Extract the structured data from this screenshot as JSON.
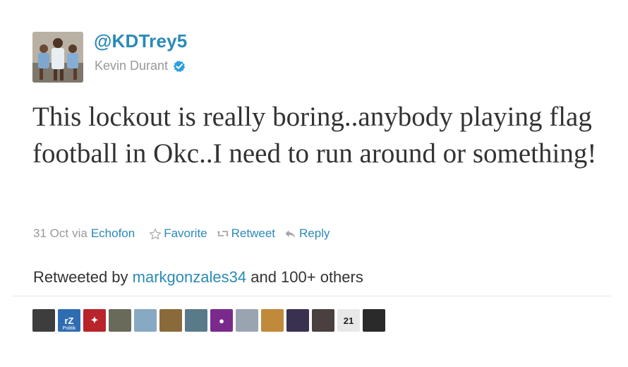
{
  "profile": {
    "handle": "@KDTrey5",
    "name": "Kevin Durant",
    "verified": true,
    "avatar_icon": "avatar-photo-icon"
  },
  "tweet": {
    "text": "This lockout is really boring..anybody playing flag football in Okc..I need to run around or something!"
  },
  "meta": {
    "date": "31 Oct",
    "via_label": "via",
    "source": "Echofon",
    "favorite_label": "Favorite",
    "retweet_label": "Retweet",
    "reply_label": "Reply"
  },
  "retweeted": {
    "prefix": "Retweeted by",
    "user": "markgonzales34",
    "suffix": "and 100+ others"
  },
  "retweeters": [
    {
      "name": "retweeter-avatar-1",
      "color": "#3d3d3d",
      "text": ""
    },
    {
      "name": "retweeter-avatar-2",
      "color": "#2f6db3",
      "text": "rZ",
      "sub": "Politik"
    },
    {
      "name": "retweeter-avatar-3",
      "color": "#b8242a",
      "text": "✦"
    },
    {
      "name": "retweeter-avatar-4",
      "color": "#6a6a5a",
      "text": ""
    },
    {
      "name": "retweeter-avatar-5",
      "color": "#87a9c4",
      "text": ""
    },
    {
      "name": "retweeter-avatar-6",
      "color": "#8a6a3a",
      "text": ""
    },
    {
      "name": "retweeter-avatar-7",
      "color": "#5a7a8a",
      "text": ""
    },
    {
      "name": "retweeter-avatar-8",
      "color": "#7a2a8a",
      "text": "●"
    },
    {
      "name": "retweeter-avatar-9",
      "color": "#9aa4b0",
      "text": ""
    },
    {
      "name": "retweeter-avatar-10",
      "color": "#c08a3a",
      "text": ""
    },
    {
      "name": "retweeter-avatar-11",
      "color": "#3a3050",
      "text": ""
    },
    {
      "name": "retweeter-avatar-12",
      "color": "#4a4040",
      "text": ""
    },
    {
      "name": "retweeter-avatar-13",
      "color": "#e8e8e8",
      "text": "21"
    },
    {
      "name": "retweeter-avatar-14",
      "color": "#2a2a2a",
      "text": ""
    }
  ],
  "colors": {
    "link": "#2b8ab7",
    "muted": "#999999",
    "text": "#333333",
    "verified": "#2b9fe0"
  }
}
